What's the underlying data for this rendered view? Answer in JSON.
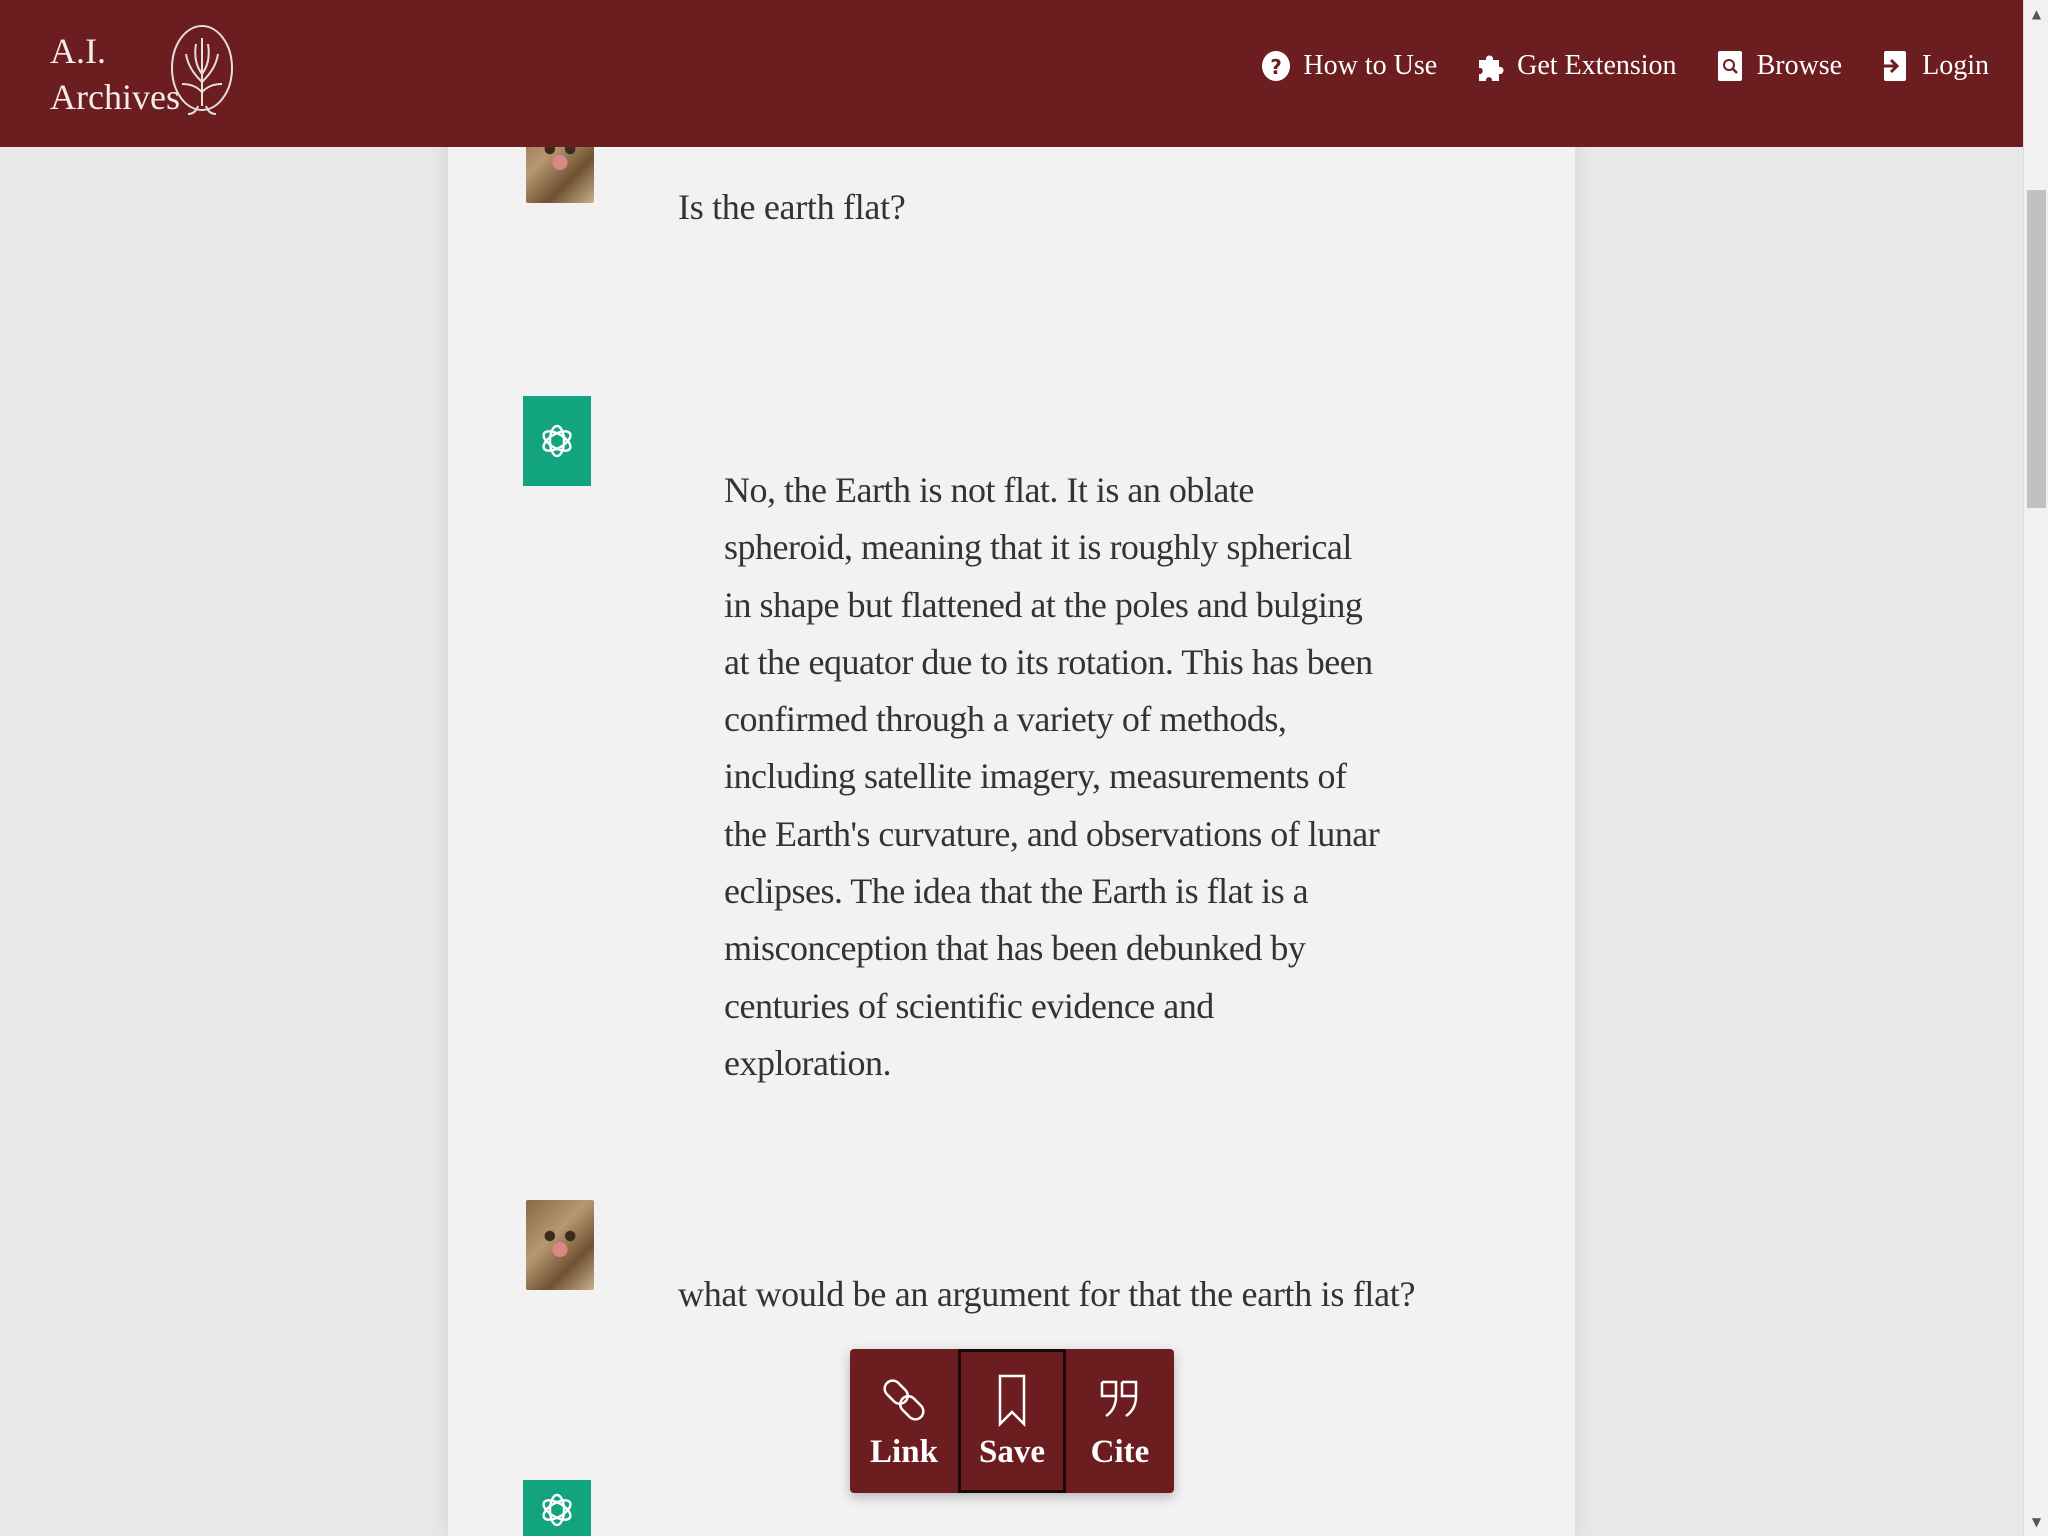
{
  "brand": {
    "line1": "A.I.",
    "line2": "Archives"
  },
  "nav": [
    {
      "label": "How to Use",
      "icon": "question-circle-icon"
    },
    {
      "label": "Get Extension",
      "icon": "puzzle-piece-icon"
    },
    {
      "label": "Browse",
      "icon": "search-document-icon"
    },
    {
      "label": "Login",
      "icon": "login-arrow-icon"
    }
  ],
  "conversation": {
    "q1": "Is the earth flat?",
    "a1": "No, the Earth is not flat. It is an oblate spheroid, meaning that it is roughly spherical in shape but flattened at the poles and bulging at the equator due to its rotation. This has been confirmed through a variety of methods, including satellite imagery, measurements of the Earth's curvature, and observations of lunar eclipses. The idea that the Earth is flat is a misconception that has been debunked by centuries of scientific evidence and exploration.",
    "q2": "what would be an argument for that the earth is flat?"
  },
  "actions": [
    {
      "label": "Link",
      "icon": "link-icon"
    },
    {
      "label": "Save",
      "icon": "bookmark-icon"
    },
    {
      "label": "Cite",
      "icon": "quote-icon"
    }
  ],
  "colors": {
    "brand": "#6c1d1f",
    "bot_avatar": "#12a37f",
    "page_bg": "#f2f2f2"
  }
}
